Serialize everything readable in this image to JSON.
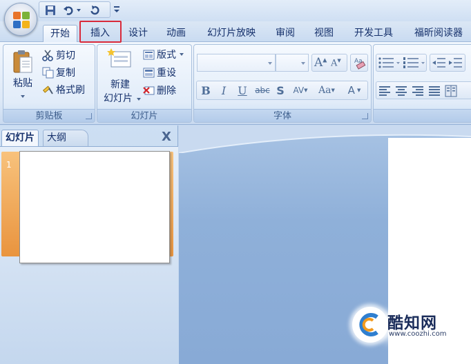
{
  "ribbon_tabs": [
    "开始",
    "插入",
    "设计",
    "动画",
    "幻灯片放映",
    "审阅",
    "视图",
    "开发工具",
    "福昕阅读器"
  ],
  "active_tab": "开始",
  "highlighted_tab": "插入",
  "clipboard": {
    "paste_label": "粘贴",
    "cut_label": "剪切",
    "copy_label": "复制",
    "format_painter_label": "格式刷",
    "group_label": "剪贴板"
  },
  "slides_group": {
    "new_slide_line1": "新建",
    "new_slide_line2": "幻灯片",
    "layout_label": "版式",
    "reset_label": "重设",
    "delete_label": "删除",
    "group_label": "幻灯片"
  },
  "font_group": {
    "group_label": "字体",
    "font_name_value": "",
    "font_size_value": "",
    "grow_label": "A",
    "shrink_label": "A",
    "bold_label": "B",
    "italic_label": "I",
    "underline_label": "U",
    "strike_label": "abc",
    "shadow_label": "S",
    "spacing_label": "AV",
    "case_label": "Aa",
    "color_label": "A"
  },
  "left_panel": {
    "tab_slides": "幻灯片",
    "tab_outline": "大纲",
    "close_glyph": "X",
    "slide_number": "1"
  },
  "watermark": {
    "title": "酷知网",
    "url": "www.coozhi.com"
  },
  "colors": {
    "highlight_border": "#d9293a",
    "thumb_selection": "#e9943e",
    "workspace": "#8fb0d9"
  }
}
